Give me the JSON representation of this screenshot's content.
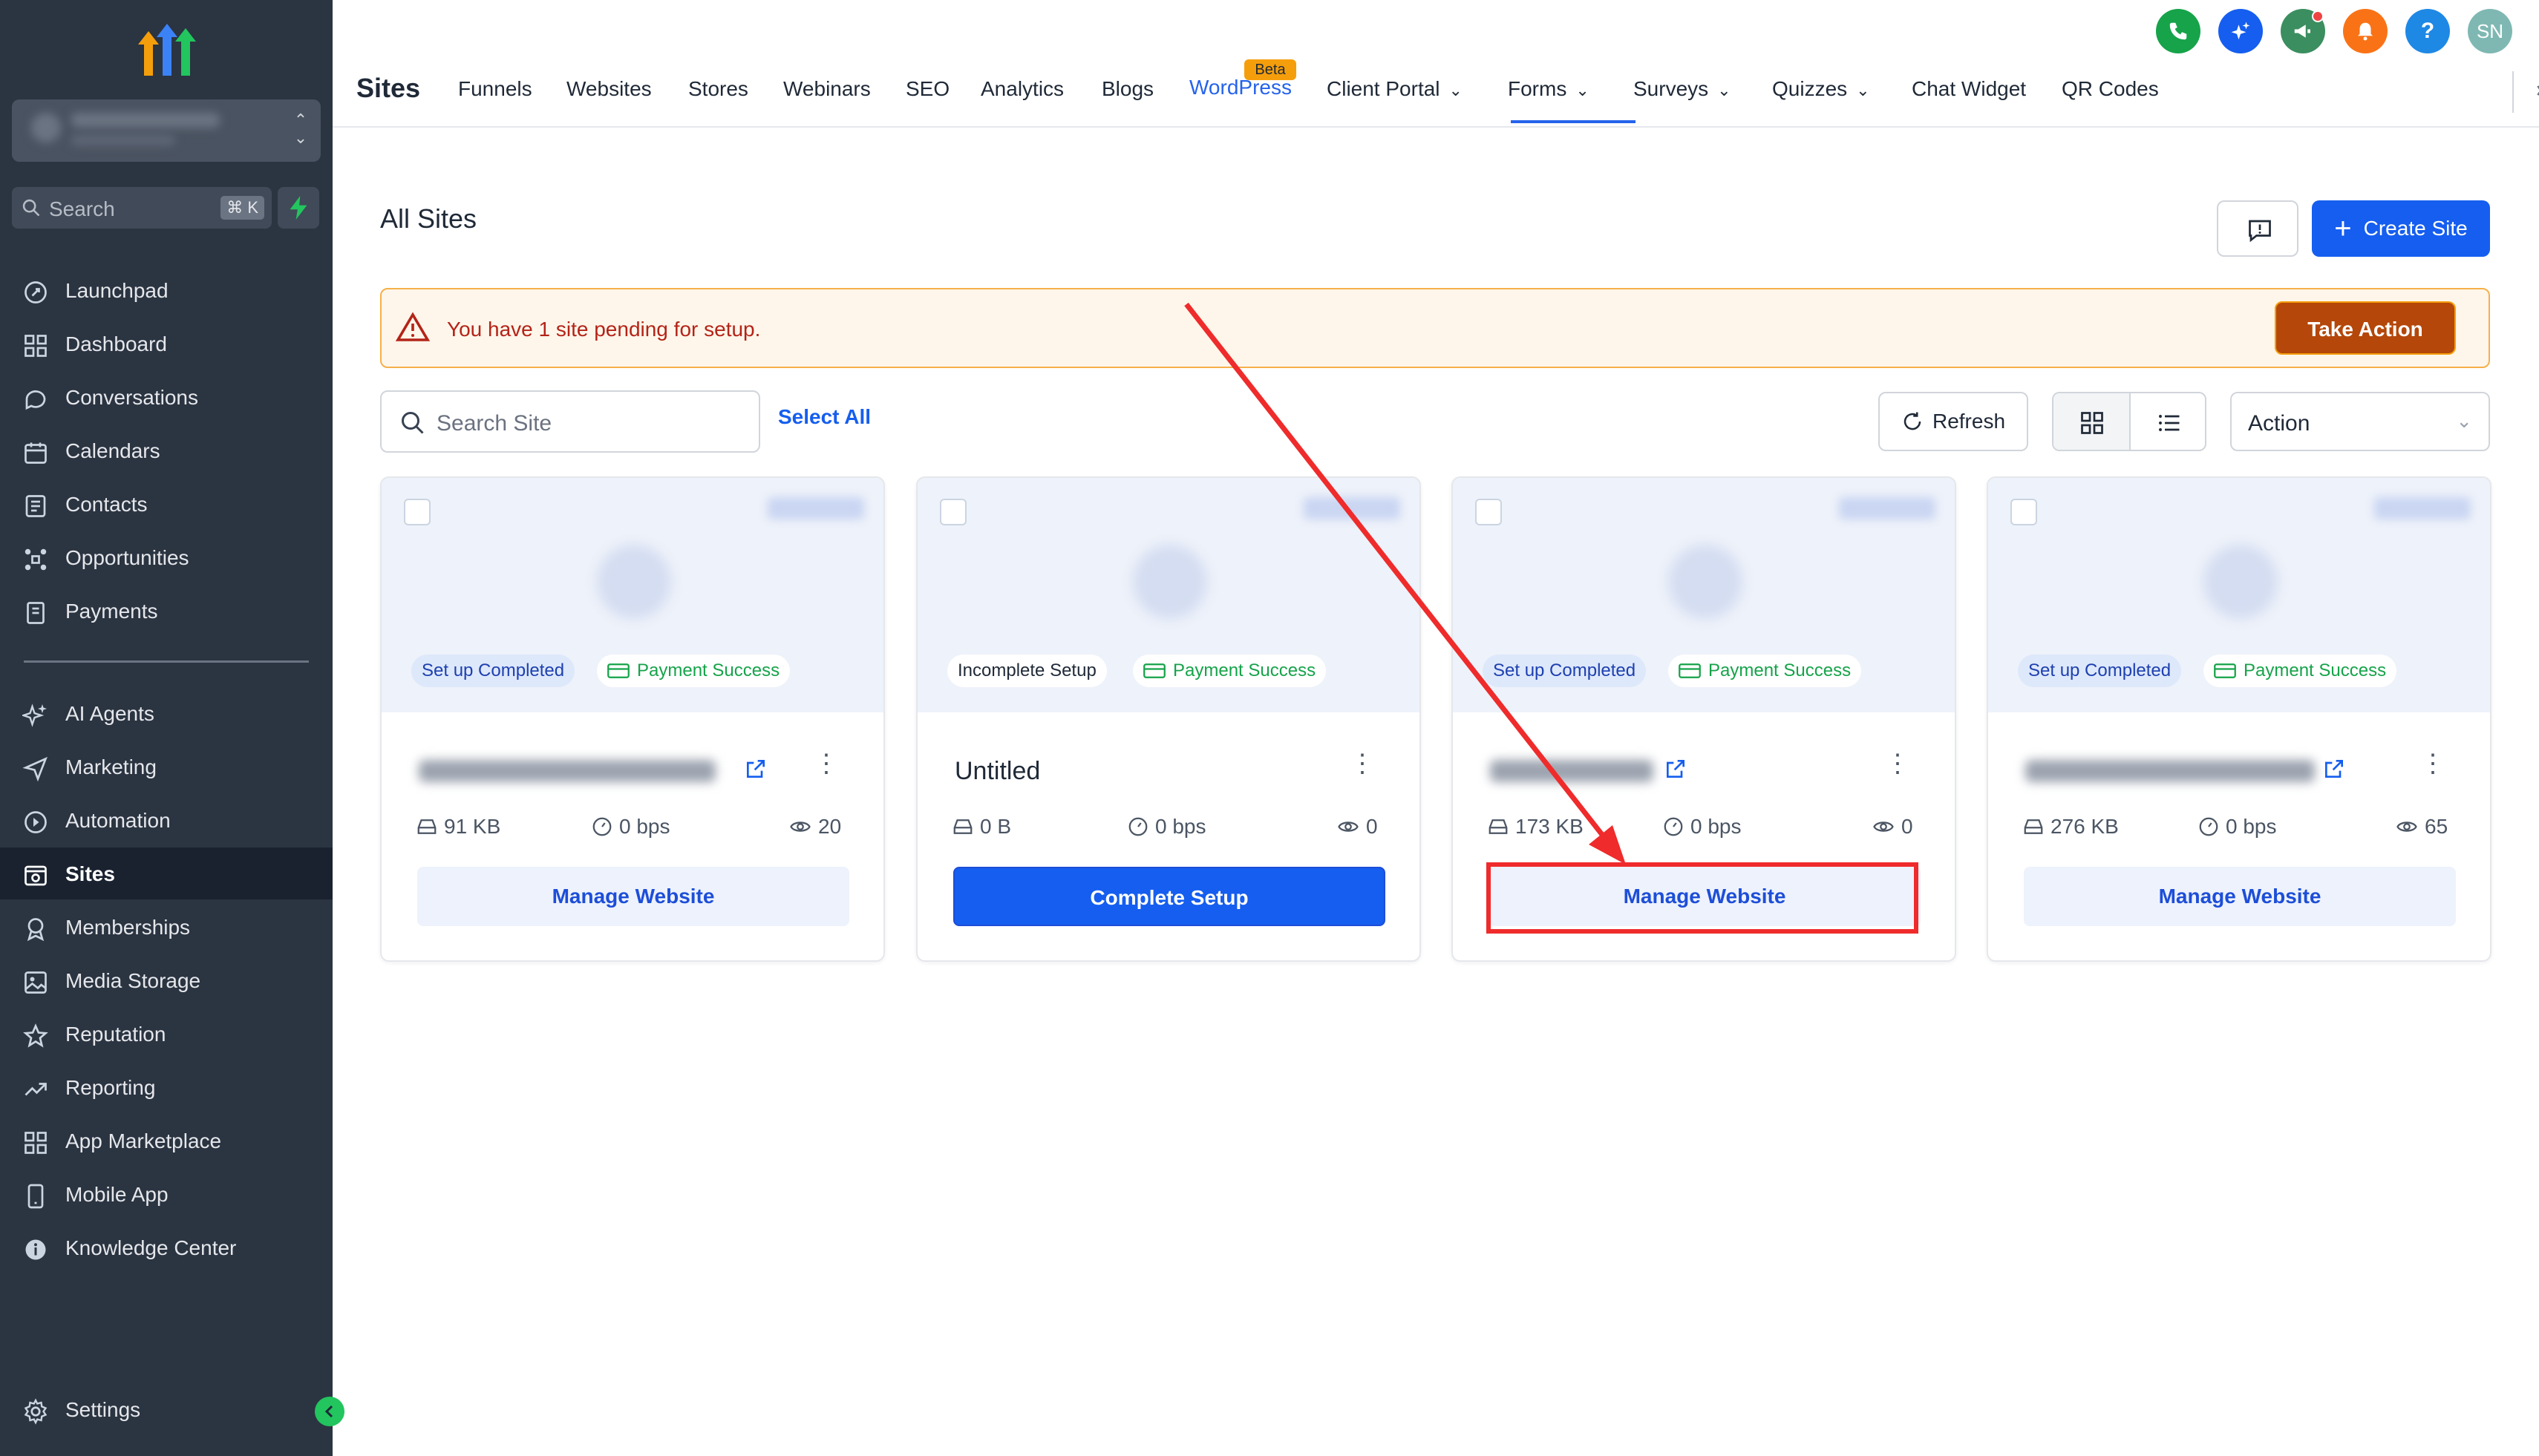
{
  "sidebar": {
    "search_placeholder": "Search",
    "search_shortcut": "⌘ K",
    "items": [
      {
        "label": "Launchpad",
        "icon": "rocket-icon"
      },
      {
        "label": "Dashboard",
        "icon": "grid-icon"
      },
      {
        "label": "Conversations",
        "icon": "chat-icon"
      },
      {
        "label": "Calendars",
        "icon": "calendar-icon"
      },
      {
        "label": "Contacts",
        "icon": "contacts-icon"
      },
      {
        "label": "Opportunities",
        "icon": "opportunities-icon"
      },
      {
        "label": "Payments",
        "icon": "payments-icon"
      },
      {
        "label": "AI Agents",
        "icon": "sparkle-icon"
      },
      {
        "label": "Marketing",
        "icon": "send-icon"
      },
      {
        "label": "Automation",
        "icon": "automation-icon"
      },
      {
        "label": "Sites",
        "icon": "sites-icon",
        "active": true
      },
      {
        "label": "Memberships",
        "icon": "membership-icon"
      },
      {
        "label": "Media Storage",
        "icon": "image-icon"
      },
      {
        "label": "Reputation",
        "icon": "star-icon"
      },
      {
        "label": "Reporting",
        "icon": "trend-icon"
      },
      {
        "label": "App Marketplace",
        "icon": "apps-icon"
      },
      {
        "label": "Mobile App",
        "icon": "mobile-icon"
      },
      {
        "label": "Knowledge Center",
        "icon": "info-icon"
      },
      {
        "label": "Settings",
        "icon": "gear-icon"
      }
    ]
  },
  "topnav": {
    "title": "Sites",
    "tabs": [
      "Funnels",
      "Websites",
      "Stores",
      "Webinars",
      "SEO",
      "Analytics",
      "Blogs",
      "WordPress",
      "Client Portal",
      "Forms",
      "Surveys",
      "Quizzes",
      "Chat Widget",
      "QR Codes"
    ],
    "active_tab": "WordPress",
    "beta_label": "Beta",
    "avatar_initials": "SN",
    "help_label": "?"
  },
  "main": {
    "page_title": "All Sites",
    "create_button": "Create Site",
    "alert_text": "You have 1 site pending for setup.",
    "alert_action": "Take Action",
    "search_placeholder": "Search Site",
    "select_all": "Select All",
    "refresh": "Refresh",
    "action_select": "Action"
  },
  "cards": [
    {
      "status": "Set up Completed",
      "payment": "Payment Success",
      "title": "",
      "size": "91 KB",
      "speed": "0 bps",
      "views": "20",
      "button": "Manage Website"
    },
    {
      "status": "Incomplete Setup",
      "payment": "Payment Success",
      "title": "Untitled",
      "size": "0 B",
      "speed": "0 bps",
      "views": "0",
      "button": "Complete Setup"
    },
    {
      "status": "Set up Completed",
      "payment": "Payment Success",
      "title": "",
      "size": "173 KB",
      "speed": "0 bps",
      "views": "0",
      "button": "Manage Website"
    },
    {
      "status": "Set up Completed",
      "payment": "Payment Success",
      "title": "",
      "size": "276 KB",
      "speed": "0 bps",
      "views": "65",
      "button": "Manage Website"
    }
  ],
  "colors": {
    "sidebar_bg": "#2b3441",
    "primary": "#155eef",
    "alert_bg": "#fef6ea",
    "alert_text": "#b42318",
    "take_action": "#b44709",
    "annotation_red": "#ef2b2b"
  }
}
